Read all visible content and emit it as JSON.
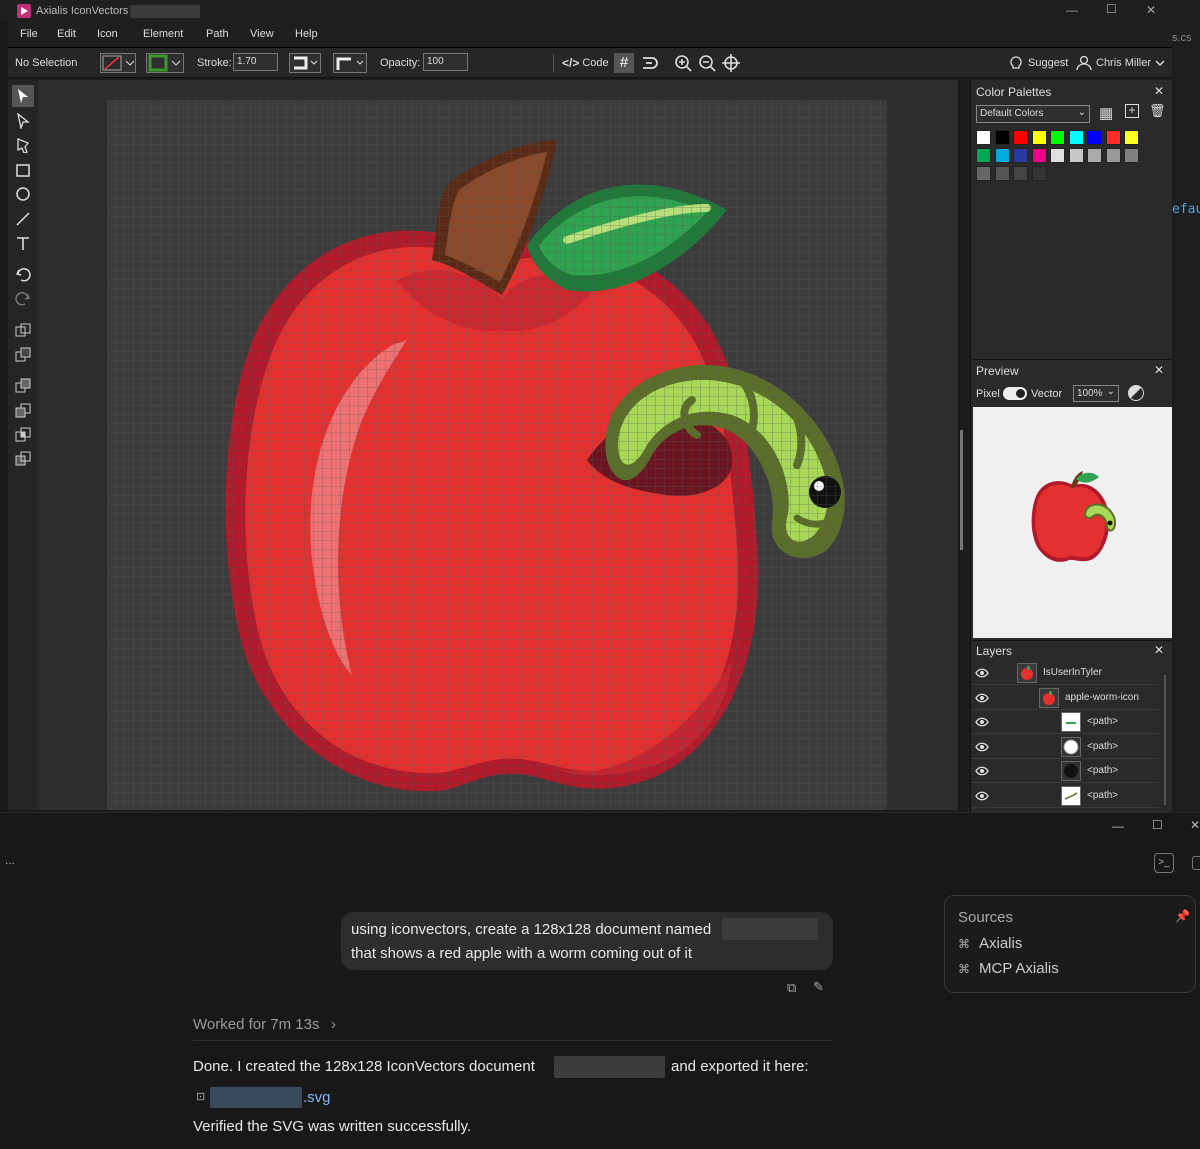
{
  "window": {
    "title": "Axialis IconVectors -",
    "controls": {
      "minimize": "—",
      "maximize": "☐",
      "close": "✕"
    },
    "edge_text": "s.cs",
    "edge_text2": "efau"
  },
  "menu": [
    "File",
    "Edit",
    "Icon",
    "Element",
    "Path",
    "View",
    "Help"
  ],
  "toolbar": {
    "selection": "No Selection",
    "stroke_label": "Stroke:",
    "stroke_value": "1.70",
    "opacity_label": "Opacity:",
    "opacity_value": "100",
    "code_label": "Code",
    "suggest_label": "Suggest",
    "user_label": "Chris Miller"
  },
  "color_palettes": {
    "title": "Color Palettes",
    "selected": "Default Colors",
    "colors": [
      "#ffffff",
      "#000000",
      "#ff0000",
      "#ffff00",
      "#00ff00",
      "#00ffff",
      "#0000ff",
      "#ff2a2a",
      "#ffff22",
      "#00aa55",
      "#00aadd",
      "#2a3aa0",
      "#ee0088",
      "#e0e0e0",
      "#c8c8c8",
      "#aaaaaa",
      "#999999",
      "#808080",
      "#666666",
      "#555555",
      "#444444",
      "#333333"
    ]
  },
  "preview": {
    "title": "Preview",
    "pixel_label": "Pixel",
    "vector_label": "Vector",
    "zoom": "100%"
  },
  "layers": {
    "title": "Layers",
    "items": [
      {
        "name": "IsUserInTyler",
        "indent": 0
      },
      {
        "name": "apple-worm-icon",
        "indent": 1
      },
      {
        "name": "<path>",
        "indent": 2
      },
      {
        "name": "<path>",
        "indent": 2
      },
      {
        "name": "<path>",
        "indent": 2
      },
      {
        "name": "<path>",
        "indent": 2
      }
    ]
  },
  "chat": {
    "ellipsis": "...",
    "user_message_line1": "using iconvectors, create a 128x128 document named",
    "user_message_line2": "that shows a red apple with a worm coming out of it",
    "worked_for": "Worked for 7m 13s",
    "response_line1_a": "Done. I created the 128x128 IconVectors document",
    "response_line1_b": "and exported it here:",
    "file_ext": ".svg",
    "response_line3": "Verified the SVG was written successfully.",
    "sources_title": "Sources",
    "sources": [
      "Axialis",
      "MCP Axialis"
    ]
  }
}
